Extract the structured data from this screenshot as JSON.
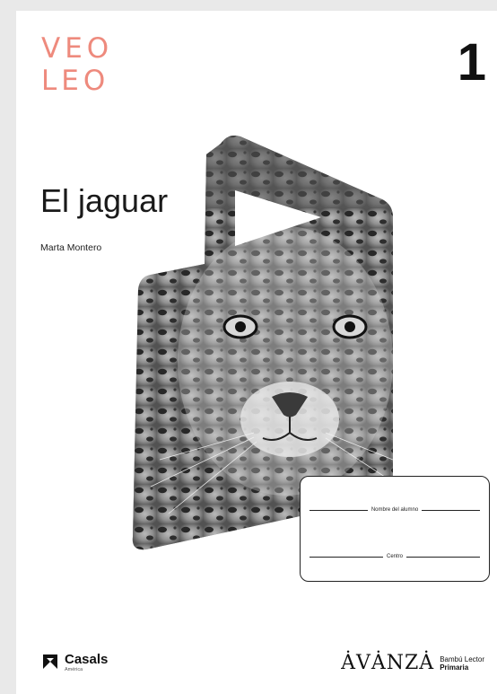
{
  "series": {
    "line1": "VEO",
    "line2": "LEO"
  },
  "level": "1",
  "book": {
    "title": "El jaguar",
    "author": "Marta Montero"
  },
  "student_box": {
    "name_label": "Nombre del alumno",
    "centro_label": "Centro"
  },
  "publisher": {
    "name": "Casals",
    "region": "América",
    "icon": "casals-logo-icon"
  },
  "brand": {
    "logo": "ȦVȦNZȦ",
    "collection": "Bambú Lector",
    "level": "Primaria"
  },
  "image": {
    "subject": "jaguar-photo",
    "accent_color": "#ee8a7d"
  }
}
